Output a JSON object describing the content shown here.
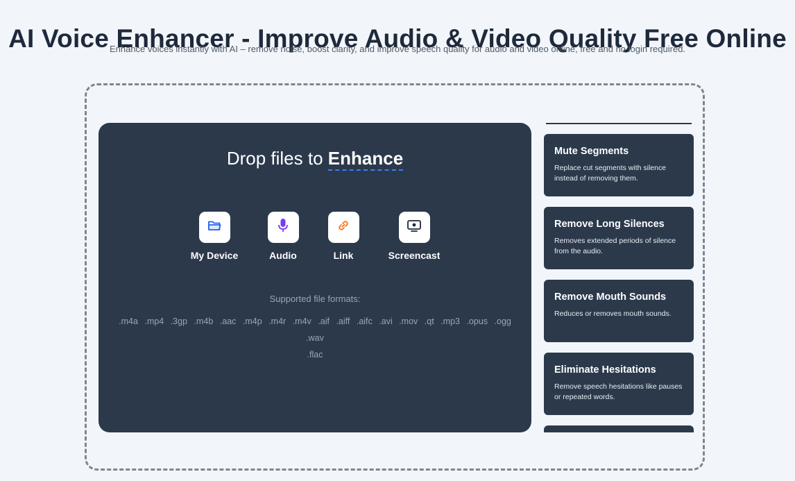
{
  "header": {
    "title": "AI Voice Enhancer - Improve Audio & Video Quality Free Online",
    "subtitle": "Enhance voices instantly with AI – remove noise, boost clarity, and improve speech quality for audio and video online, free and no login required."
  },
  "upload": {
    "heading_prefix": "Drop files to ",
    "heading_accent": "Enhance",
    "sources": [
      {
        "label": "My Device",
        "icon": "folder-icon",
        "color": "#2563eb"
      },
      {
        "label": "Audio",
        "icon": "microphone-icon",
        "color": "#7c3aed"
      },
      {
        "label": "Link",
        "icon": "link-icon",
        "color": "#f97316"
      },
      {
        "label": "Screencast",
        "icon": "screen-record-icon",
        "color": "#1f2a3a"
      }
    ],
    "formats_title": "Supported file formats:",
    "formats": [
      ".m4a",
      ".mp4",
      ".3gp",
      ".m4b",
      ".aac",
      ".m4p",
      ".m4r",
      ".m4v",
      ".aif",
      ".aiff",
      ".aifc",
      ".avi",
      ".mov",
      ".qt",
      ".mp3",
      ".opus",
      ".ogg",
      ".wav",
      ".flac"
    ]
  },
  "features": [
    {
      "title": "Mute Segments",
      "description": "Replace cut segments with silence instead of removing them."
    },
    {
      "title": "Remove Long Silences",
      "description": "Removes extended periods of silence from the audio."
    },
    {
      "title": "Remove Mouth Sounds",
      "description": "Reduces or removes mouth sounds."
    },
    {
      "title": "Eliminate Hesitations",
      "description": "Remove speech hesitations like pauses or repeated words."
    }
  ],
  "colors": {
    "background": "#f2f6fb",
    "panel": "#2b394b",
    "accent_underline": "#3b82f6"
  }
}
